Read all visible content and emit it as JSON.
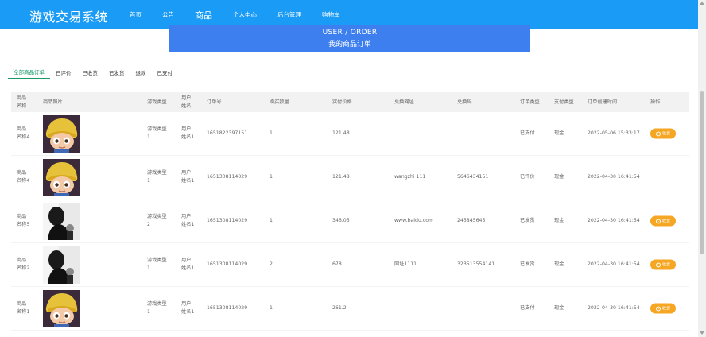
{
  "brand": "游戏交易系统",
  "nav": [
    {
      "label": "首页",
      "active": false
    },
    {
      "label": "公告",
      "active": false
    },
    {
      "label": "商品",
      "active": true
    },
    {
      "label": "个人中心",
      "active": false
    },
    {
      "label": "后台管理",
      "active": false
    },
    {
      "label": "购物车",
      "active": false
    }
  ],
  "banner": {
    "line1": "USER / ORDER",
    "line2": "我的商品订单"
  },
  "tabs": [
    {
      "label": "全部商品订单",
      "active": true
    },
    {
      "label": "已评价",
      "active": false
    },
    {
      "label": "已收货",
      "active": false
    },
    {
      "label": "已发货",
      "active": false
    },
    {
      "label": "退款",
      "active": false
    },
    {
      "label": "已支付",
      "active": false
    }
  ],
  "table": {
    "headers": [
      "商品\n名称",
      "商品照片",
      "游戏类型",
      "用户\n姓名",
      "订单号",
      "购买数量",
      "实付价格",
      "兑换网址",
      "兑换码",
      "订单类型",
      "支付类型",
      "订单创建时间",
      "操作"
    ],
    "rows": [
      {
        "name": "商品\n名称4",
        "photo": "cartoon-boy",
        "type": "游戏类型\n1",
        "user": "用户\n姓名1",
        "order_no": "1651822397151",
        "qty": "1",
        "price": "121.48",
        "url": "",
        "code": "",
        "status": "已支付",
        "pay": "现金",
        "time": "2022-05-06 15:33:17",
        "action": "收货"
      },
      {
        "name": "商品\n名称4",
        "photo": "cartoon-boy",
        "type": "游戏类型\n1",
        "user": "用户\n姓名1",
        "order_no": "1651308114029",
        "qty": "1",
        "price": "121.48",
        "url": "wangzhi 111",
        "code": "5646434151",
        "status": "已评价",
        "pay": "现金",
        "time": "2022-04-30 16:41:54",
        "action": ""
      },
      {
        "name": "商品\n名称5",
        "photo": "bw-man",
        "type": "游戏类型\n2",
        "user": "用户\n姓名1",
        "order_no": "1651308114029",
        "qty": "1",
        "price": "346.05",
        "url": "www.baidu.com",
        "code": "245845645",
        "status": "已发货",
        "pay": "现金",
        "time": "2022-04-30 16:41:54",
        "action": "收货"
      },
      {
        "name": "商品\n名称2",
        "photo": "bw-man",
        "type": "游戏类型\n1",
        "user": "用户\n姓名1",
        "order_no": "1651308114029",
        "qty": "2",
        "price": "678",
        "url": "网址1111",
        "code": "323513554141",
        "status": "已发货",
        "pay": "现金",
        "time": "2022-04-30 16:41:54",
        "action": "收货"
      },
      {
        "name": "商品\n名称1",
        "photo": "cartoon-boy",
        "type": "游戏类型\n1",
        "user": "用户\n姓名1",
        "order_no": "1651308114029",
        "qty": "1",
        "price": "261.2",
        "url": "",
        "code": "",
        "status": "已支付",
        "pay": "现金",
        "time": "2022-04-30 16:41:54",
        "action": "收货"
      }
    ]
  },
  "colors": {
    "nav": "#1a9bf5",
    "banner": "#3e7ff0",
    "tab_active": "#1a9b6c",
    "button": "#f5a623"
  }
}
